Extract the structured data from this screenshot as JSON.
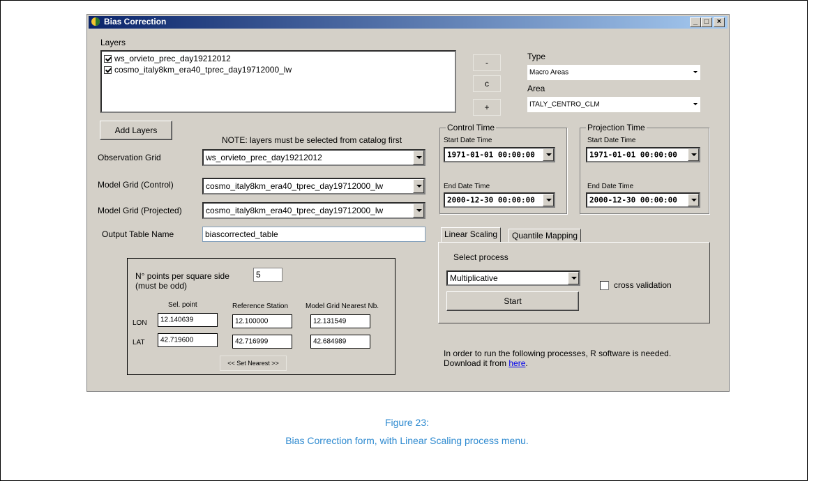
{
  "window": {
    "title": "Bias Correction",
    "min": "_",
    "max": "□",
    "close": "×"
  },
  "layers": {
    "label": "Layers",
    "items": [
      {
        "name": "ws_orvieto_prec_day19212012",
        "checked": true
      },
      {
        "name": "cosmo_italy8km_era40_tprec_day19712000_lw",
        "checked": true
      }
    ],
    "btn_remove": "-",
    "btn_clear": "c",
    "btn_add": "+",
    "add_layers": "Add Layers",
    "note": "NOTE: layers must be selected from catalog first"
  },
  "type": {
    "label": "Type",
    "value": "Macro Areas"
  },
  "area": {
    "label": "Area",
    "value": "ITALY_CENTRO_CLM"
  },
  "grids": {
    "observation": {
      "label": "Observation Grid",
      "value": "ws_orvieto_prec_day19212012"
    },
    "model_control": {
      "label": "Model Grid (Control)",
      "value": "cosmo_italy8km_era40_tprec_day19712000_lw"
    },
    "model_projected": {
      "label": "Model Grid (Projected)",
      "value": "cosmo_italy8km_era40_tprec_day19712000_lw"
    },
    "output": {
      "label": "Output Table Name",
      "value": "biascorrected_table"
    }
  },
  "control_time": {
    "title": "Control Time",
    "start_label": "Start Date Time",
    "start": "1971-01-01  00:00:00",
    "end_label": "End Date Time",
    "end": "2000-12-30  00:00:00"
  },
  "projection_time": {
    "title": "Projection Time",
    "start_label": "Start Date Time",
    "start": "1971-01-01  00:00:00",
    "end_label": "End Date Time",
    "end": "2000-12-30  00:00:00"
  },
  "points": {
    "label_line1": "N° points per square side",
    "label_line2": "(must be odd)",
    "value": "5",
    "col_sel": "Sel. point",
    "col_ref": "Reference Station",
    "col_model": "Model Grid Nearest Nb.",
    "lon_label": "LON",
    "lat_label": "LAT",
    "lon": {
      "sel": "12.140639",
      "ref": "12.100000",
      "model": "12.131549"
    },
    "lat": {
      "sel": "42.719600",
      "ref": "42.716999",
      "model": "42.684989"
    },
    "set_nearest": "<< Set Nearest >>"
  },
  "tabs": {
    "linear": "Linear Scaling",
    "quantile": "Quantile Mapping"
  },
  "process": {
    "label": "Select process",
    "value": "Multiplicative",
    "cross_validation": "cross validation",
    "start": "Start"
  },
  "note_r": {
    "text": "In order to run the following processes, R software is needed. Download it from ",
    "link": "here",
    "end": "."
  },
  "caption": {
    "line1": "Figure 23:",
    "line2": "Bias Correction form, with Linear Scaling process menu."
  }
}
